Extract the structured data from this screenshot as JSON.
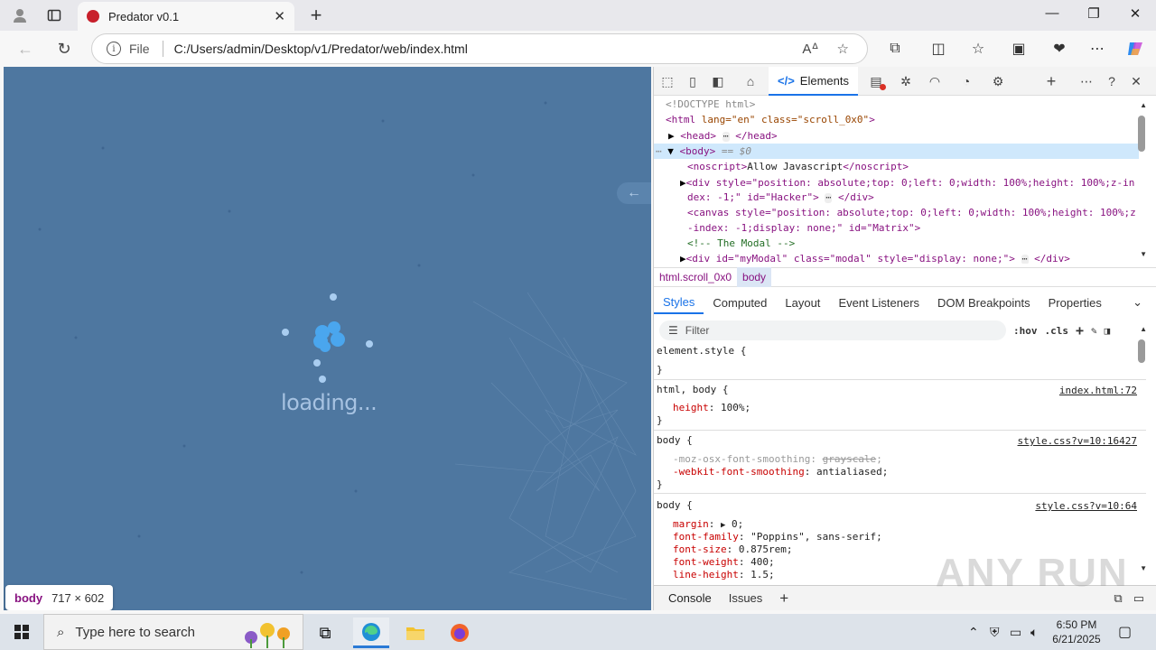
{
  "browser": {
    "tab_title": "Predator v0.1",
    "omnibox_scheme": "File",
    "url": "C:/Users/admin/Desktop/v1/Predator/web/index.html"
  },
  "page": {
    "loading_text": "loading...",
    "background_color": "#4e77a0",
    "inspect_badge": {
      "tag": "body",
      "dims": "717 × 602"
    }
  },
  "devtools": {
    "active_tab": "Elements",
    "dom_lines": [
      {
        "text": "<!DOCTYPE html>"
      },
      {
        "tag_open": "<html",
        "attrs": " lang=\"en\" class=\"scroll_0x0\"",
        "close": ">"
      },
      {
        "text": "<head>",
        "ellipsis": "⋯",
        "end": "</head>"
      },
      {
        "text": "<body>",
        "hint": "== $0"
      },
      {
        "noscript_open": "<noscript>",
        "noscript_text": "Allow Javascript",
        "noscript_close": "</noscript>"
      },
      {
        "l1": "<div style=\"position: absolute;top: 0;left: 0;width: 100%;height: 100%;z-in",
        "l2": "dex: -1;\" id=\"Hacker\">",
        "ellipsis": "⋯",
        "end": "</div>"
      },
      {
        "l1": "<canvas style=\"position: absolute;top: 0;left: 0;width: 100%;height: 100%;z",
        "l2": "-index: -1;display: none;\" id=\"Matrix\">"
      },
      {
        "comment": "<!-- The Modal -->"
      },
      {
        "l1": "<div id=\"myModal\" class=\"modal\" style=\"display: none;\">",
        "ellipsis": "⋯",
        "end": "</div>"
      }
    ],
    "breadcrumbs": [
      "html.scroll_0x0",
      "body"
    ],
    "subtabs": [
      "Styles",
      "Computed",
      "Layout",
      "Event Listeners",
      "DOM Breakpoints",
      "Properties"
    ],
    "filter_placeholder": "Filter",
    "filter_buttons": [
      ":hov",
      ".cls"
    ],
    "styles": {
      "r1_sel": "element.style {",
      "r1_close": "}",
      "r2_sel": "html, body {",
      "r2_src": "index.html:72",
      "r2_p1": "height",
      "r2_v1": "100%;",
      "r2_close": "}",
      "r3_sel": "body {",
      "r3_src": "style.css?v=10:16427",
      "r3_p1": "-moz-osx-font-smoothing",
      "r3_v1": "grayscale",
      "r3_p2": "-webkit-font-smoothing",
      "r3_v2": "antialiased;",
      "r3_close": "}",
      "r4_sel": "body {",
      "r4_src": "style.css?v=10:64",
      "r4_p1": "margin",
      "r4_v1": "0;",
      "r4_p2": "font-family",
      "r4_v2": "\"Poppins\", sans-serif;",
      "r4_p3": "font-size",
      "r4_v3": "0.875rem;",
      "r4_p4": "font-weight",
      "r4_v4": "400;",
      "r4_p5": "line-height",
      "r4_v5": "1.5;"
    },
    "drawer_tabs": [
      "Console",
      "Issues"
    ]
  },
  "watermark": "ANY RUN",
  "taskbar": {
    "search_placeholder": "Type here to search",
    "time": "6:50 PM",
    "date": "6/21/2025"
  }
}
